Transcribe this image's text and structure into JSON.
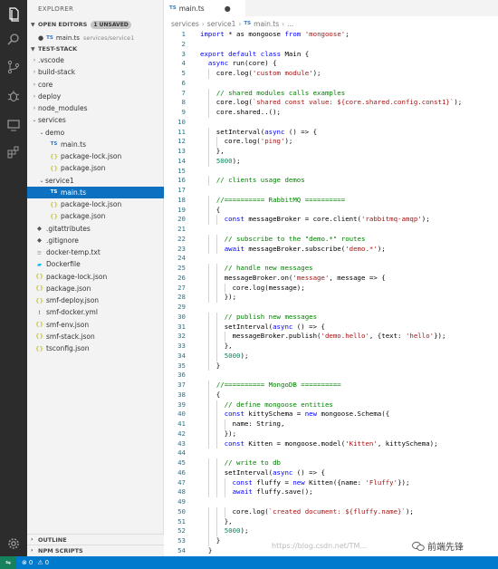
{
  "sidebar": {
    "title": "EXPLORER",
    "open_editors": {
      "label": "OPEN EDITORS",
      "badge": "1 UNSAVED",
      "file": "main.ts",
      "path": "services/service1"
    },
    "workspace": "TEST-STACK",
    "tree": [
      {
        "label": ".vscode",
        "type": "folder",
        "depth": 1,
        "expanded": false
      },
      {
        "label": "build-stack",
        "type": "folder",
        "depth": 1,
        "expanded": false
      },
      {
        "label": "core",
        "type": "folder",
        "depth": 1,
        "expanded": false
      },
      {
        "label": "deploy",
        "type": "folder",
        "depth": 1,
        "expanded": false
      },
      {
        "label": "node_modules",
        "type": "folder",
        "depth": 1,
        "expanded": false
      },
      {
        "label": "services",
        "type": "folder",
        "depth": 1,
        "expanded": true
      },
      {
        "label": "demo",
        "type": "folder",
        "depth": 2,
        "expanded": true
      },
      {
        "label": "main.ts",
        "type": "ts",
        "depth": 3
      },
      {
        "label": "package-lock.json",
        "type": "json",
        "depth": 3
      },
      {
        "label": "package.json",
        "type": "json",
        "depth": 3
      },
      {
        "label": "service1",
        "type": "folder",
        "depth": 2,
        "expanded": true
      },
      {
        "label": "main.ts",
        "type": "ts",
        "depth": 3,
        "selected": true
      },
      {
        "label": "package-lock.json",
        "type": "json",
        "depth": 3
      },
      {
        "label": "package.json",
        "type": "json",
        "depth": 3
      },
      {
        "label": ".gitattributes",
        "type": "git",
        "depth": 1
      },
      {
        "label": ".gitignore",
        "type": "git",
        "depth": 1
      },
      {
        "label": "docker-temp.txt",
        "type": "txt",
        "depth": 1
      },
      {
        "label": "Dockerfile",
        "type": "docker",
        "depth": 1
      },
      {
        "label": "package-lock.json",
        "type": "json",
        "depth": 1
      },
      {
        "label": "package.json",
        "type": "json",
        "depth": 1
      },
      {
        "label": "smf-deploy.json",
        "type": "json",
        "depth": 1
      },
      {
        "label": "smf-docker.yml",
        "type": "yml",
        "depth": 1
      },
      {
        "label": "smf-env.json",
        "type": "json",
        "depth": 1
      },
      {
        "label": "smf-stack.json",
        "type": "json",
        "depth": 1
      },
      {
        "label": "tsconfig.json",
        "type": "json",
        "depth": 1
      }
    ],
    "outline_label": "OUTLINE",
    "npm_label": "NPM SCRIPTS"
  },
  "editor": {
    "tab_label": "main.ts",
    "breadcrumb": [
      "services",
      "service1",
      "main.ts",
      "..."
    ],
    "lines": [
      "import * as mongoose from 'mongoose';",
      "",
      "export default class Main {",
      "  async run(core) {",
      "    core.log('custom module');",
      "",
      "    // shared modules calls examples",
      "    core.log(`shared const value: ${core.shared.config.const1}`);",
      "    core.shared.module1.func1();",
      "",
      "    setInterval(async () => {",
      "      core.log('ping');",
      "    },",
      "    5000);",
      "",
      "    // clients usage demos",
      "",
      "    //========== RabbitMQ ==========",
      "    {",
      "      const messageBroker = core.client('rabbitmq-amqp');",
      "",
      "      // subscribe to the \"demo.*\" routes",
      "      await messageBroker.subscribe('demo.*');",
      "",
      "      // handle new messages",
      "      messageBroker.on('message', message => {",
      "        core.log(message);",
      "      });",
      "",
      "      // publish new messages",
      "      setInterval(async () => {",
      "        messageBroker.publish('demo.hello', {text: 'hello'});",
      "      },",
      "      5000);",
      "    }",
      "",
      "    //========== MongoDB ==========",
      "    {",
      "      // define mongoose entities",
      "      const kittySchema = new mongoose.Schema({",
      "        name: String,",
      "      });",
      "      const Kitten = mongoose.model('Kitten', kittySchema);",
      "",
      "      // write to db",
      "      setInterval(async () => {",
      "        const fluffy = new Kitten({name: 'Fluffy'});",
      "        await fluffy.save();",
      "",
      "        core.log(`created document: ${fluffy.name}`);",
      "      },",
      "      5000);",
      "    }",
      "  }"
    ]
  },
  "status": {
    "errors": "0",
    "warnings": "0"
  },
  "watermark": {
    "url": "https://blog.csdn.net/TM...",
    "brand": "前端先锋"
  }
}
